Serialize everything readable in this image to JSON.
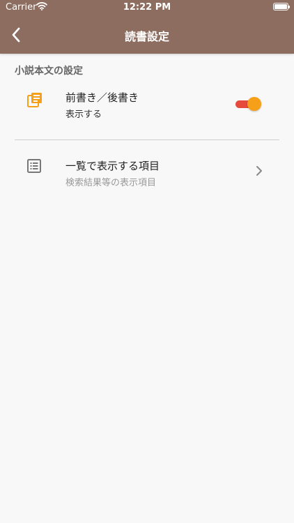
{
  "status_bar": {
    "carrier": "Carrier",
    "time": "12:22 PM"
  },
  "nav": {
    "title": "読書設定"
  },
  "section": {
    "title": "小説本文の設定",
    "items": [
      {
        "title": "前書き／後書き",
        "subtitle": "表示する",
        "toggle_on": true,
        "icon": "book-stack-icon"
      },
      {
        "title": "一覧で表示する項目",
        "subtitle": "検索結果等の表示項目",
        "icon": "list-icon"
      }
    ]
  },
  "colors": {
    "header_bg": "#8c6d60",
    "accent_orange": "#f6a019",
    "toggle_track": "#e64a3b",
    "icon_gray": "#777777",
    "background": "#f8f8f8"
  }
}
